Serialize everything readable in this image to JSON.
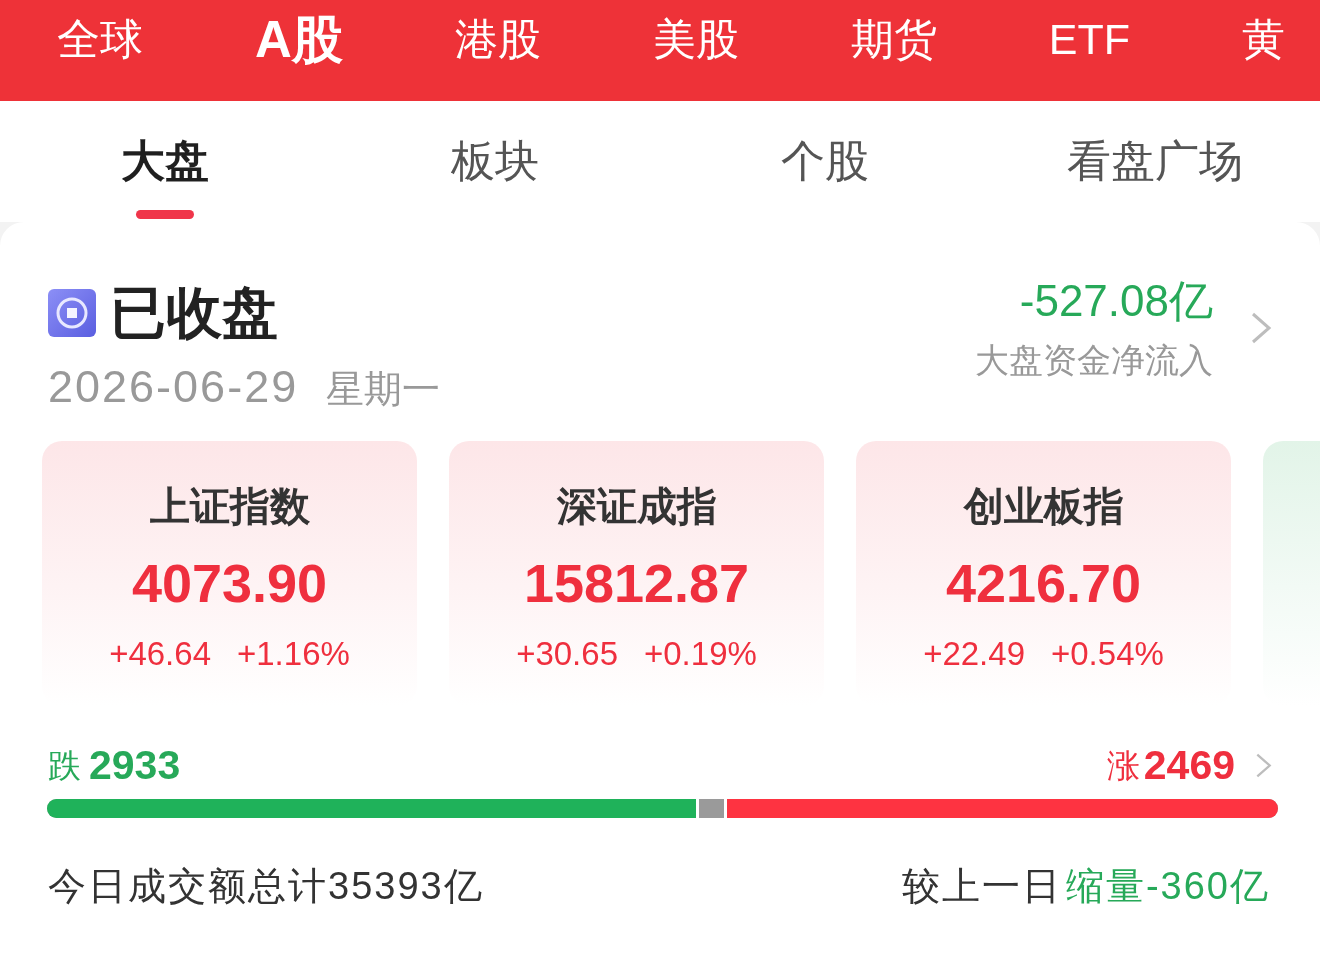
{
  "market_nav": [
    {
      "label": "全球",
      "selected": false
    },
    {
      "label": "A股",
      "selected": true
    },
    {
      "label": "港股",
      "selected": false
    },
    {
      "label": "美股",
      "selected": false
    },
    {
      "label": "期货",
      "selected": false
    },
    {
      "label": "ETF",
      "selected": false
    },
    {
      "label": "黄",
      "selected": false
    }
  ],
  "tabs": [
    {
      "label": "大盘",
      "selected": true
    },
    {
      "label": "板块",
      "selected": false
    },
    {
      "label": "个股",
      "selected": false
    },
    {
      "label": "看盘广场",
      "selected": false
    }
  ],
  "status": {
    "label": "已收盘",
    "date": "2026-06-29",
    "weekday": "星期一"
  },
  "fund_flow": {
    "value": "-527.08亿",
    "down": true,
    "label": "大盘资金净流入"
  },
  "indices": [
    {
      "name": "上证指数",
      "value": "4073.90",
      "change": "+46.64",
      "change_pct": "+1.16%",
      "down": false
    },
    {
      "name": "深证成指",
      "value": "15812.87",
      "change": "+30.65",
      "change_pct": "+0.19%",
      "down": false
    },
    {
      "name": "创业板指",
      "value": "4216.70",
      "change": "+22.49",
      "change_pct": "+0.54%",
      "down": false
    },
    {
      "down": true
    }
  ],
  "breadth": {
    "fall": {
      "label": "跌",
      "count": "2933",
      "level": 0.53
    },
    "rise": {
      "label": "涨",
      "count": "2469",
      "level": 0.45
    }
  },
  "turnover": {
    "text": "今日成交额总计35393亿",
    "compare_label": "较上一日",
    "compare_value": "缩量-360亿",
    "down": true
  }
}
